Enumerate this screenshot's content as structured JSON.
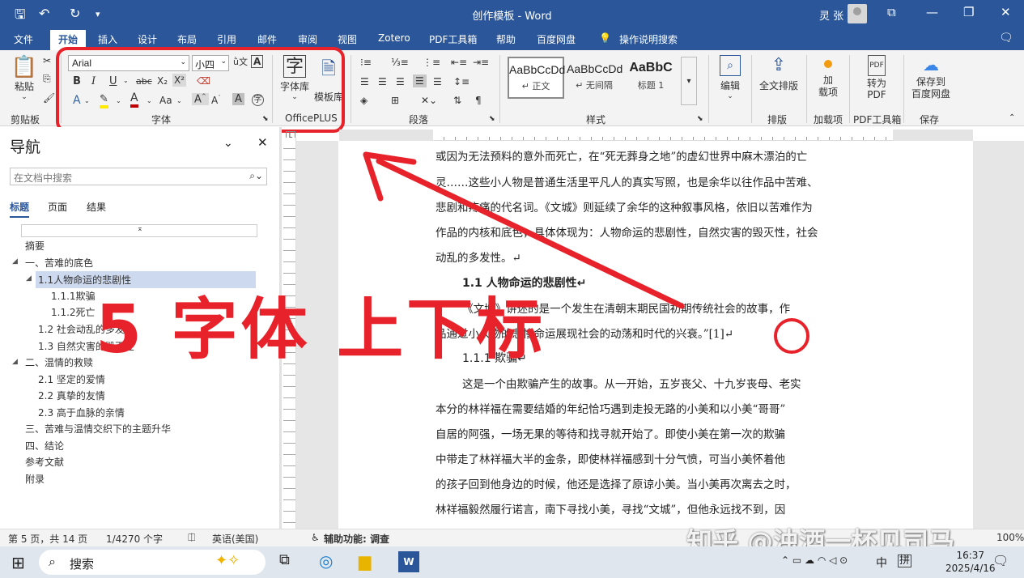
{
  "titlebar": {
    "title": "创作模板 - Word",
    "user": "灵 张"
  },
  "menu": {
    "tabs": [
      "文件",
      "开始",
      "插入",
      "设计",
      "布局",
      "引用",
      "邮件",
      "审阅",
      "视图",
      "Zotero",
      "PDF工具箱",
      "帮助",
      "百度网盘",
      "操作说明搜索"
    ]
  },
  "ribbon": {
    "paste_label": "粘贴",
    "clipboard_label": "剪贴板",
    "font_name": "Arial",
    "font_size": "小四",
    "font_group_label": "字体",
    "font_lib_label": "字体库",
    "template_lib_label": "模板库",
    "officeplus_label": "OfficePLUS",
    "paragraph_label": "段落",
    "styles_label": "样式",
    "styles": [
      {
        "preview": "AaBbCcDd",
        "name": "↵ 正文"
      },
      {
        "preview": "AaBbCcDd",
        "name": "↵ 无间隔"
      },
      {
        "preview": "AaBbC",
        "name": "标题 1"
      }
    ],
    "edit_label": "编辑",
    "fulltext_label": "全文排版",
    "layout_label": "排版",
    "addin_label": "加\n载项",
    "addin_group_label": "加载项",
    "topdf_label": "转为\nPDF",
    "pdftools_label": "PDF工具箱",
    "savebaidu_label": "保存到\n百度网盘",
    "save_label": "保存"
  },
  "nav": {
    "title": "导航",
    "search_placeholder": "在文档中搜索",
    "tabs": [
      "标题",
      "页面",
      "结果"
    ],
    "items": [
      "摘要",
      "一、苦难的底色",
      "1.1人物命运的悲剧性",
      "1.1.1欺骗",
      "1.1.2死亡",
      "1.2 社会动乱的多发",
      "1.3 自然灾害的毁灭性",
      "二、温情的救赎",
      "2.1 坚定的爱情",
      "2.2 真挚的友情",
      "2.3 高于血脉的亲情",
      "三、苦难与温情交织下的主题升华",
      "四、结论",
      "参考文献",
      "附录"
    ]
  },
  "document": {
    "lines": [
      "或因为无法预料的意外而死亡，在“死无葬身之地”的虚幻世界中麻木漂泊的亡",
      "灵……这些小人物是普通生活里平凡人的真实写照，也是余华以往作品中苦难、",
      "悲剧和疼痛的代名词。《文城》则延续了余华的这种叙事风格，依旧以苦难作为",
      "作品的内核和底色，具体体现为：人物命运的悲剧性，自然灾害的毁灭性，社会",
      "动乱的多发性。↵"
    ],
    "heading_1_1": "1.1 人物命运的悲剧性↵",
    "para2": [
      "“《文城》讲述的是一个发生在清朝末期民国初期传统社会的故事，作",
      "品通过小人物的悲惨命运展现社会的动荡和时代的兴衰。”[1]↵"
    ],
    "heading_1_1_1": "1.1.1 欺骗↵",
    "para3": [
      "这是一个由欺骗产生的故事。从一开始，五岁丧父、十九岁丧母、老实",
      "本分的林祥福在需要结婚的年纪恰巧遇到走投无路的小美和以小美“哥哥”",
      "自居的阿强，一场无果的等待和找寻就开始了。即使小美在第一次的欺骗",
      "中带走了林祥福大半的金条，即使林祥福感到十分气愤，可当小美怀着他",
      "的孩子回到他身边的时候，他还是选择了原谅小美。当小美再次离去之时，",
      "林祥福毅然履行诺言，南下寻找小美，寻找“文城”，但他永远找不到，因"
    ]
  },
  "status": {
    "page": "第 5 页，共 14 页",
    "words": "1/4270 个字",
    "lang": "英语(美国)",
    "access": "辅助功能: 调查",
    "zoom": "100%"
  },
  "taskbar": {
    "search": "搜索",
    "time": "16:37",
    "date": "2025/4/16",
    "ime": "中",
    "ime2": "拼"
  },
  "overlay": {
    "caption": "5 字体 上下标",
    "watermark": "知乎 @浊酒一杯见司马"
  },
  "colors": {
    "word_blue": "#2b579a",
    "annotation_red": "#e8222a"
  }
}
